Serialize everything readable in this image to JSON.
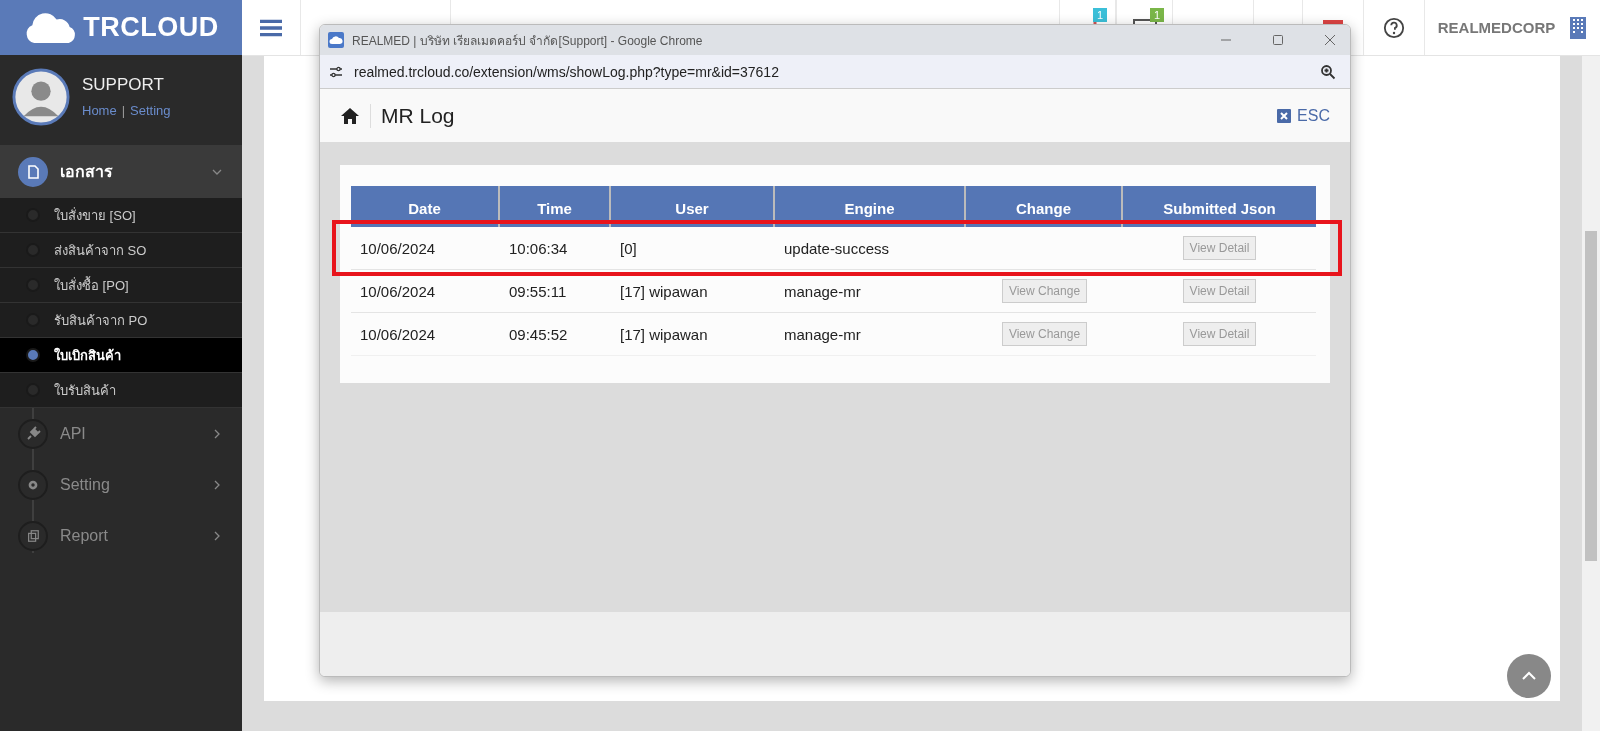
{
  "app": {
    "logo": "TRCLOUD",
    "badges": [
      "1",
      "1"
    ],
    "company": "REALMEDCORP"
  },
  "user": {
    "name": "SUPPORT",
    "links": [
      "Home",
      "Setting"
    ],
    "separator": "|"
  },
  "sidebar": [
    {
      "label": "เอกสาร",
      "expanded": true,
      "children": [
        {
          "label": "ใบสั่งขาย [SO]",
          "selected": false
        },
        {
          "label": "ส่งสินค้าจาก SO",
          "selected": false
        },
        {
          "label": "ใบสั่งซื้อ [PO]",
          "selected": false
        },
        {
          "label": "รับสินค้าจาก PO",
          "selected": false
        },
        {
          "label": "ใบเบิกสินค้า",
          "selected": true
        },
        {
          "label": "ใบรับสินค้า",
          "selected": false
        }
      ]
    },
    {
      "label": "API",
      "expanded": false
    },
    {
      "label": "Setting",
      "expanded": false
    },
    {
      "label": "Report",
      "expanded": false
    }
  ],
  "popup": {
    "title": "REALMED | บริษัท เรียลเมดคอร์ป จำกัด[Support] - Google Chrome",
    "url": "realmed.trcloud.co/extension/wms/showLog.php?type=mr&id=37612",
    "heading": "MR Log",
    "close": "ESC",
    "table": {
      "columns": [
        "Date",
        "Time",
        "User",
        "Engine",
        "Change",
        "Submitted Json"
      ],
      "rows": [
        {
          "cells": [
            "10/06/2024",
            "10:06:34",
            "[0]",
            "update-success"
          ],
          "change": null,
          "detail": "View Detail",
          "highlighted": true
        },
        {
          "cells": [
            "10/06/2024",
            "09:55:11",
            "[17] wipawan",
            "manage-mr"
          ],
          "change": "View Change",
          "detail": "View Detail",
          "highlighted": false
        },
        {
          "cells": [
            "10/06/2024",
            "09:45:52",
            "[17] wipawan",
            "manage-mr"
          ],
          "change": "View Change",
          "detail": "View Detail",
          "highlighted": false
        }
      ]
    }
  }
}
